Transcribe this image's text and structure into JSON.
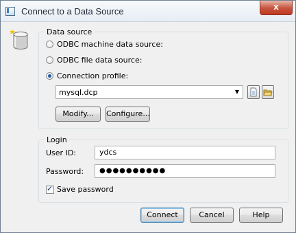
{
  "window": {
    "title": "Connect to a Data Source",
    "close_glyph": "x"
  },
  "data_source": {
    "group_label": "Data source",
    "options": [
      {
        "label": "ODBC machine data source:",
        "selected": false
      },
      {
        "label": "ODBC file data source:",
        "selected": false
      },
      {
        "label": "Connection profile:",
        "selected": true
      }
    ],
    "profile_value": "mysql.dcp",
    "dropdown_glyph": "▼",
    "modify_label": "Modify...",
    "configure_label": "Configure..."
  },
  "login": {
    "group_label": "Login",
    "user_id_label": "User ID:",
    "user_id_value": "ydcs",
    "password_label": "Password:",
    "password_value": "●●●●●●●●●●",
    "save_password_label": "Save password",
    "save_password_checked": true,
    "check_glyph": "✓"
  },
  "buttons": {
    "connect": "Connect",
    "cancel": "Cancel",
    "help": "Help"
  },
  "icons": {
    "app": "window-icon",
    "database": "database-icon",
    "new_file": "new-document-icon",
    "folder": "open-folder-icon",
    "close": "close-icon"
  }
}
